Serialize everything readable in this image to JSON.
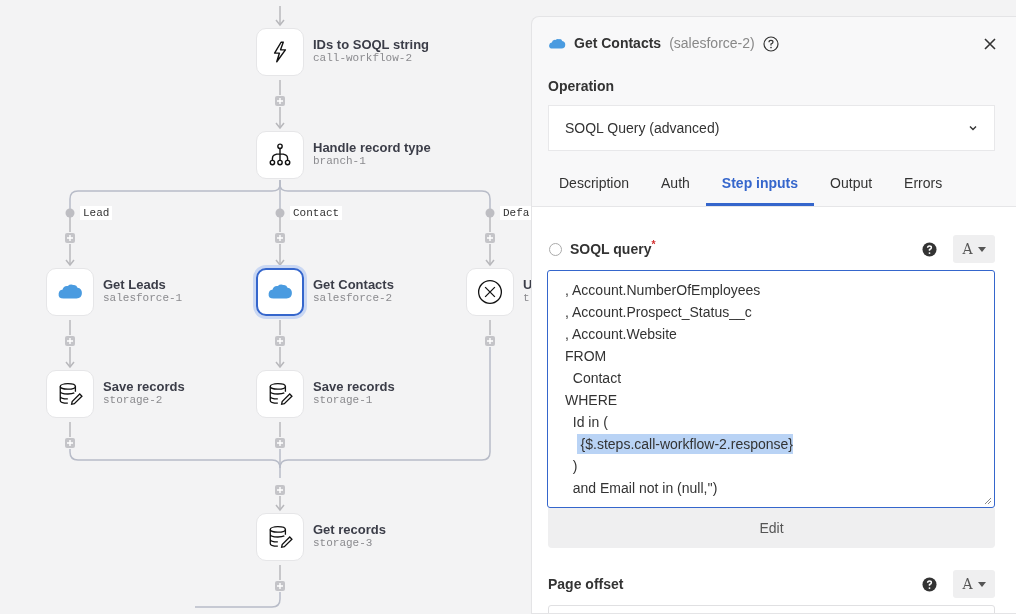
{
  "flow": [
    {
      "kind": "function",
      "title": "IDs to SOQL string",
      "id": "call-workflow-2",
      "selected": false
    },
    {
      "kind": "branch",
      "title": "Handle record type",
      "id": "branch-1",
      "selected": false,
      "branches": [
        {
          "label": "Lead",
          "steps": [
            {
              "kind": "salesforce",
              "title": "Get Leads",
              "id": "salesforce-1",
              "selected": false
            },
            {
              "kind": "storage",
              "title": "Save records",
              "id": "storage-2",
              "selected": false
            }
          ]
        },
        {
          "label": "Contact",
          "steps": [
            {
              "kind": "salesforce",
              "title": "Get Contacts",
              "id": "salesforce-2",
              "selected": true
            },
            {
              "kind": "storage",
              "title": "Save records",
              "id": "storage-1",
              "selected": false
            }
          ]
        },
        {
          "label": "Defa",
          "steps": [
            {
              "kind": "error",
              "title": "U",
              "id": "t",
              "selected": false
            }
          ]
        }
      ]
    },
    {
      "kind": "storage",
      "title": "Get records",
      "id": "storage-3",
      "selected": false
    }
  ],
  "panel": {
    "title": "Get Contacts",
    "subtitle": "(salesforce-2)",
    "operation_label": "Operation",
    "operation_value": "SOQL Query (advanced)",
    "tabs": [
      {
        "label": "Description",
        "selected": false
      },
      {
        "label": "Auth",
        "selected": false
      },
      {
        "label": "Step inputs",
        "selected": true
      },
      {
        "label": "Output",
        "selected": false
      },
      {
        "label": "Errors",
        "selected": false
      }
    ],
    "fields": [
      {
        "label": "SOQL query",
        "required_mark": "*",
        "checked": false,
        "mode": "A",
        "lines": [
          {
            "text": ", Account.NumberOfEmployees",
            "highlighted": false
          },
          {
            "text": ", Account.Prospect_Status__c",
            "highlighted": false
          },
          {
            "text": ", Account.Website",
            "highlighted": false
          },
          {
            "text": "FROM",
            "highlighted": false
          },
          {
            "text": "  Contact",
            "highlighted": false
          },
          {
            "text": "WHERE",
            "highlighted": false
          },
          {
            "text": "  Id in (",
            "highlighted": false
          },
          {
            "text": "    {$.steps.call-workflow-2.response}",
            "highlighted": true
          },
          {
            "text": "  )",
            "highlighted": false
          },
          {
            "text": "  and Email not in (null,'')",
            "highlighted": false
          }
        ],
        "button": "Edit"
      },
      {
        "label": "Page offset",
        "mode": "A"
      }
    ]
  }
}
